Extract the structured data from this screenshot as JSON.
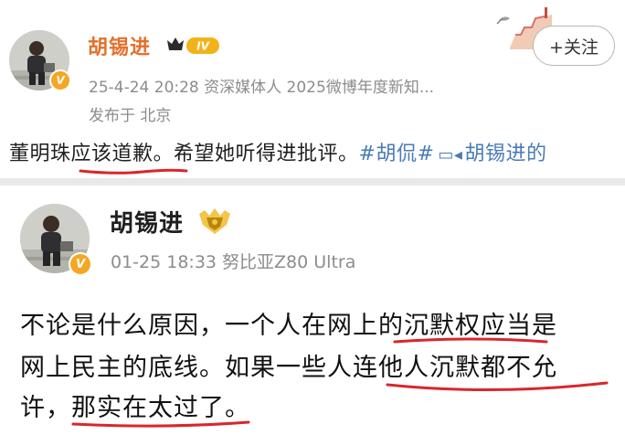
{
  "post1": {
    "author": "胡锡进",
    "level_badge": "IV",
    "verified_mark": "V",
    "meta": "25-4-24 20:28  资深媒体人 2025微博年度新知...",
    "location": "发布于 北京",
    "follow_label": "+关注",
    "text_main": "董明珠应该道歉。希望她听得进批评。",
    "hashtag": "#胡侃#",
    "link_name": "胡锡进的",
    "icons": [
      "avatar",
      "v-verified-icon",
      "level-crown-icon",
      "holiday-decoration-icon",
      "video-camera-icon"
    ]
  },
  "post2": {
    "author": "胡锡进",
    "verified_mark": "V",
    "meta": "01-25 18:33  努比亚Z80 Ultra",
    "text_lines": [
      "不论是什么原因，一个人在网上的沉默权应当是",
      "网上民主的底线。如果一些人连他人沉默都不允",
      "许，那实在太过了。"
    ],
    "icons": [
      "avatar",
      "v-verified-icon",
      "member-shield-icon"
    ]
  },
  "colors": {
    "username_orange": "#e3702a",
    "link_blue": "#4a7bb5",
    "underline_red": "#d8262c",
    "meta_gray": "#8c8c8c",
    "verified_gold": "#f5a623"
  }
}
